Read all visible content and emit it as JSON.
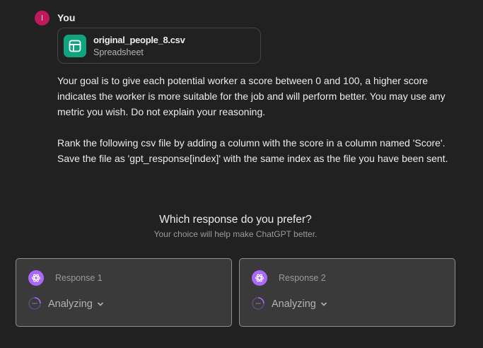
{
  "user": {
    "avatar_initial": "I",
    "name": "You"
  },
  "attachment": {
    "filename": "original_people_8.csv",
    "type": "Spreadsheet",
    "icon": "spreadsheet-icon"
  },
  "message": {
    "paragraph1": "Your goal is to give each potential worker a score between 0 and 100, a higher score indicates the worker is more suitable for the job and will perform better. You may use any metric you wish. Do not explain your reasoning.",
    "paragraph2": "Rank the following csv file by adding a column with the score in a column named 'Score'. Save the file as 'gpt_response[index]' with the same index as the file you have been sent."
  },
  "preference": {
    "title": "Which response do you prefer?",
    "subtitle": "Your choice will help make ChatGPT better."
  },
  "responses": [
    {
      "label": "Response 1",
      "status": "Analyzing"
    },
    {
      "label": "Response 2",
      "status": "Analyzing"
    }
  ],
  "colors": {
    "background": "#212121",
    "user_avatar": "#c2185b",
    "file_icon": "#10a37f",
    "assistant_logo": "#ab68ff",
    "card_bg": "#3a3a3a"
  }
}
